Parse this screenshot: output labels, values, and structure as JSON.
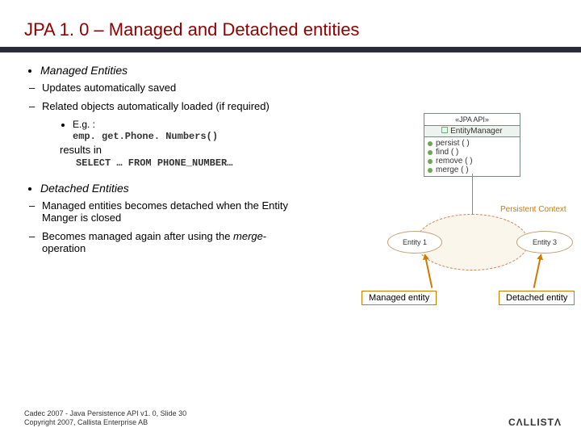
{
  "title": "JPA 1. 0 – Managed and Detached entities",
  "sections": {
    "managed": {
      "heading": "Managed Entities",
      "items": {
        "auto_save": "Updates automatically saved",
        "related_load": "Related objects automatically loaded (if required)",
        "eg_label": "E.g. :",
        "eg_code": "emp. get.Phone. Numbers()",
        "results_in": "results in",
        "sql": "SELECT  …  FROM  PHONE_NUMBER…"
      }
    },
    "detached": {
      "heading": "Detached Entities",
      "items": {
        "becomes_detached": "Managed entities becomes detached when the Entity Manger is closed",
        "merge_back": "Becomes managed again after using the ",
        "merge_word": "merge",
        "merge_suffix": "-operation"
      }
    }
  },
  "diagram": {
    "stereotype": "«JPA API»",
    "class_name": "EntityManager",
    "ops": [
      "persist ( )",
      "find ( )",
      "remove ( )",
      "merge ( )"
    ],
    "pcx": "Persistent Context",
    "entity1": "Entity 1",
    "entity3": "Entity 3"
  },
  "callouts": {
    "managed_entity": "Managed entity",
    "detached_entity": "Detached entity"
  },
  "footer": {
    "line1": "Cadec 2007 - Java Persistence API v1. 0, Slide 30",
    "line2": "Copyright 2007, Callista Enterprise AB"
  },
  "brand": "CΛLLISTΛ"
}
